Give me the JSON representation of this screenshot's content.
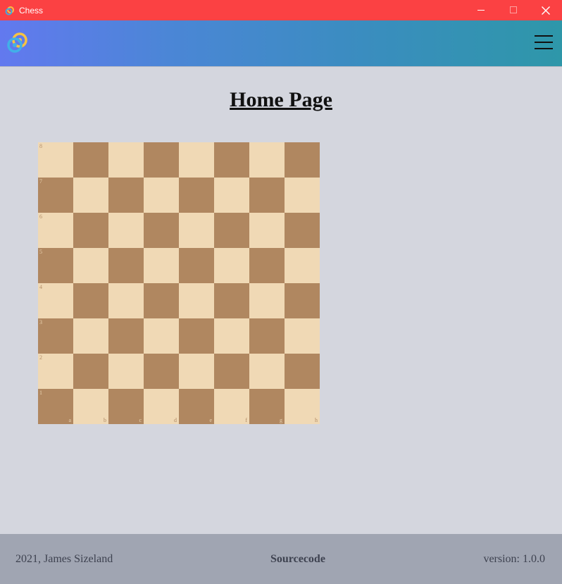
{
  "window": {
    "title": "Chess",
    "titlebar_color": "#fb4143",
    "controls": [
      "minimize-icon",
      "maximize-icon",
      "close-icon"
    ]
  },
  "navbar": {
    "logo": "app-logo-icon",
    "menu": "hamburger-menu-icon"
  },
  "main": {
    "title": "Home Page"
  },
  "board": {
    "light_color": "#f0d9b5",
    "dark_color": "#b08760",
    "ranks": [
      "8",
      "7",
      "6",
      "5",
      "4",
      "3",
      "2",
      "1"
    ],
    "files": [
      "a",
      "b",
      "c",
      "d",
      "e",
      "f",
      "g",
      "h"
    ]
  },
  "footer": {
    "copyright": "2021, James Sizeland",
    "link": "Sourcecode",
    "version": "version: 1.0.0"
  }
}
